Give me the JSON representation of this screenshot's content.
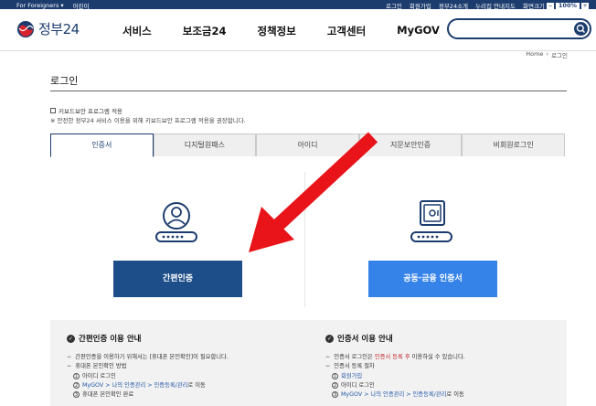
{
  "topbar": {
    "foreigners": "For Foreigners ▾",
    "kids": "어린이",
    "login": "로그인",
    "join": "회원가입",
    "intro": "정부24소개",
    "sitemap": "누리집 안내지도",
    "zoom_label": "화면크기",
    "zoom_minus": "−",
    "zoom_value": "100%",
    "zoom_plus": "+"
  },
  "header": {
    "logo_text": "정부24",
    "nav": [
      "서비스",
      "보조금24",
      "정책정보",
      "고객센터",
      "MyGOV"
    ],
    "search_placeholder": ""
  },
  "breadcrumb": {
    "home": "Home",
    "sep": "›",
    "current": "로그인"
  },
  "page": {
    "title": "로그인",
    "keyboard_option": "키보드보안 프로그램 적용",
    "keyboard_note": "※ 안전한 정부24 서비스 이용을 위해 키보드보안 프로그램 적용을 권장합니다."
  },
  "tabs": [
    "인증서",
    "디지털원패스",
    "아이디",
    "지문보안인증",
    "비회원로그인"
  ],
  "buttons": {
    "simple_auth": "간편인증",
    "joint_cert": "공동·금융 인증서"
  },
  "info": {
    "left": {
      "title": "간편인증 이용 안내",
      "line1": "간편인증을 이용하기 위해서는 [휴대폰 본인확인]이 필요합니다.",
      "line2": "휴대폰 본인확인 방법",
      "step1": "아이디 로그인",
      "step2_a": "MyGOV > 나의 인증관리 > 인증등록/관리",
      "step2_b": "로 이동",
      "step3": "휴대폰 본인확인 완료"
    },
    "right": {
      "title": "인증서 이용 안내",
      "line1_a": "인증서 로그인은 ",
      "line1_b": "인증서 등록 후",
      "line1_c": " 이용하실 수 있습니다.",
      "line2": "인증서 등록 절차",
      "step1": "회원가입",
      "step2": "아이디 로그인",
      "step3_a": "MyGOV > 나의 인증관리 > 인증등록/관리",
      "step3_b": "로 이동"
    }
  },
  "icons": {
    "simple_auth_icon": "person-card-icon",
    "cert_icon": "safe-card-icon",
    "overlay": "red-arrow-annotation"
  },
  "colors": {
    "navy": "#1c3c6e",
    "simple_btn": "#1d4e89",
    "cert_btn": "#3583e8",
    "arrow": "#e8141a"
  }
}
